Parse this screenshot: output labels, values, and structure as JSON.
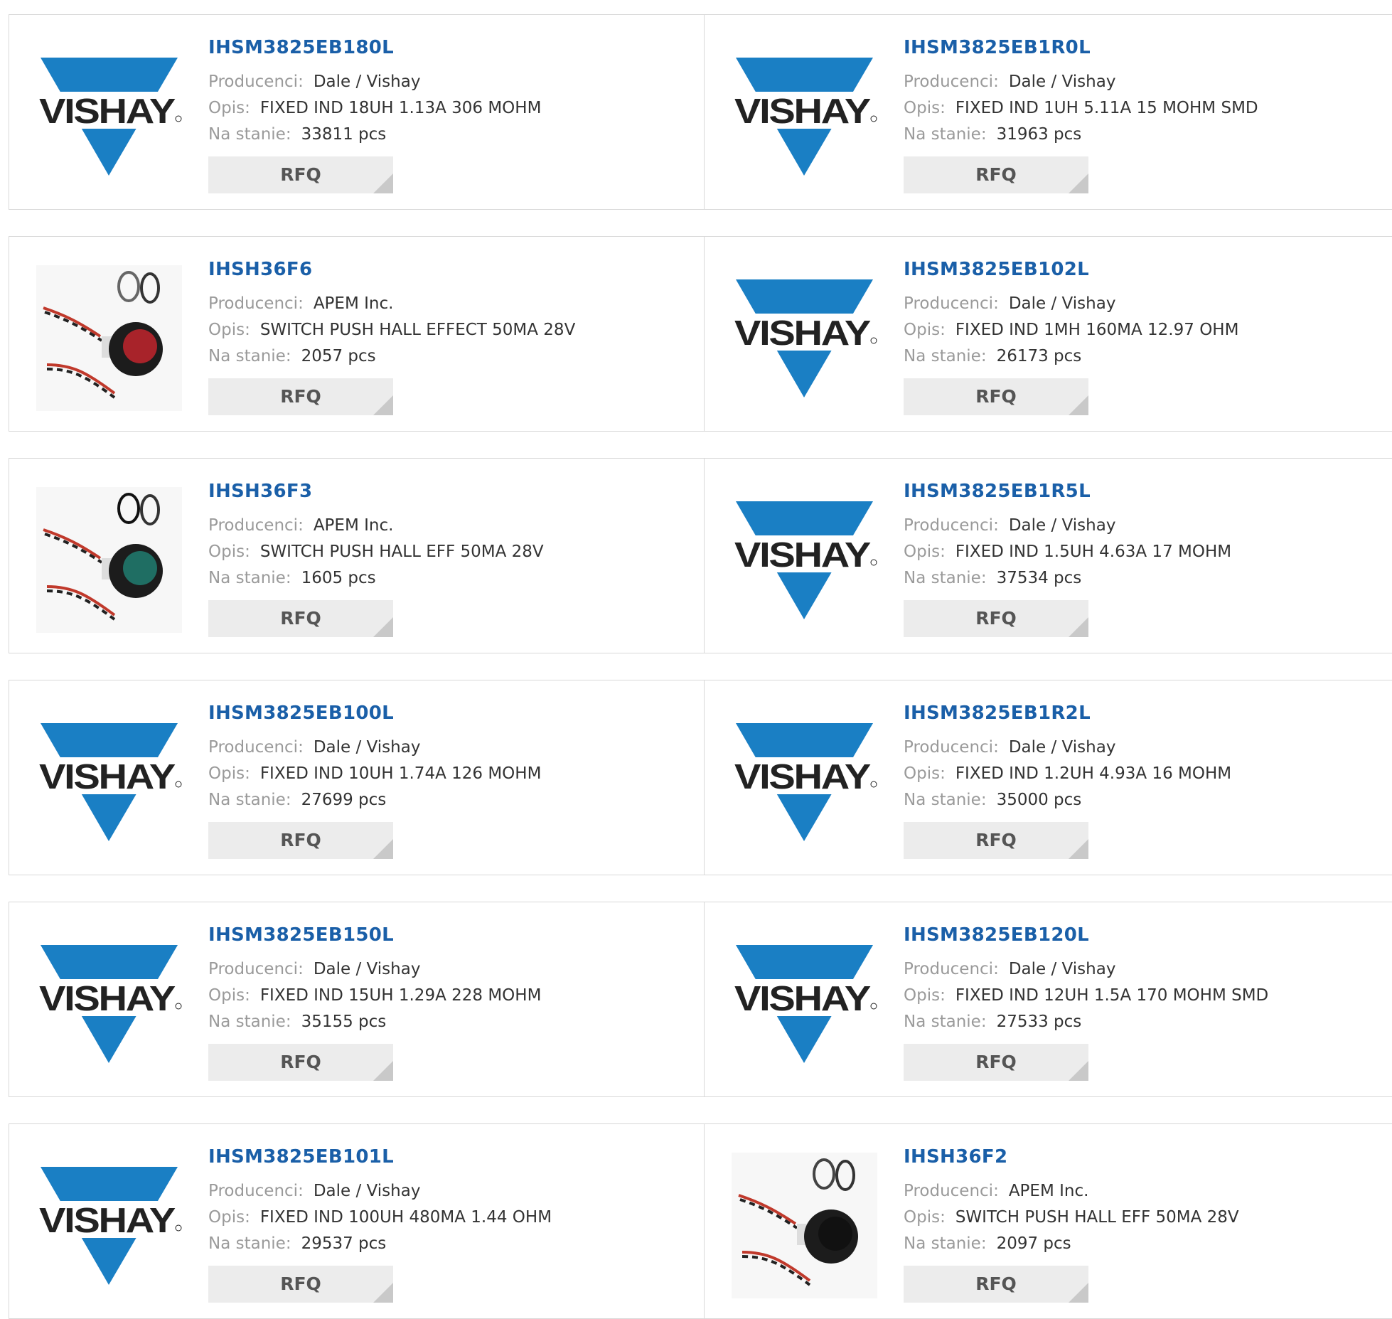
{
  "labels": {
    "manufacturer": "Producenci:",
    "description": "Opis:",
    "stock": "Na stanie:",
    "rfq": "RFQ"
  },
  "colors": {
    "link": "#1a5fa8",
    "vishay_blue": "#1a7fc4",
    "button_bg": "#ececec"
  },
  "products": [
    {
      "part": "IHSM3825EB180L",
      "manufacturer": "Dale / Vishay",
      "description": "FIXED IND 18UH 1.13A 306 MOHM",
      "stock": "33811 pcs",
      "image": "vishay-logo",
      "logo_text": "VISHAY"
    },
    {
      "part": "IHSM3825EB1R0L",
      "manufacturer": "Dale / Vishay",
      "description": "FIXED IND 1UH 5.11A 15 MOHM SMD",
      "stock": "31963 pcs",
      "image": "vishay-logo",
      "logo_text": "VISHAY"
    },
    {
      "part": "IHSH36F6",
      "manufacturer": "APEM Inc.",
      "description": "SWITCH PUSH HALL EFFECT 50MA 28V",
      "stock": "2057 pcs",
      "image": "red-switch-photo"
    },
    {
      "part": "IHSM3825EB102L",
      "manufacturer": "Dale / Vishay",
      "description": "FIXED IND 1MH 160MA 12.97 OHM",
      "stock": "26173 pcs",
      "image": "vishay-logo",
      "logo_text": "VISHAY"
    },
    {
      "part": "IHSH36F3",
      "manufacturer": "APEM Inc.",
      "description": "SWITCH PUSH HALL EFF 50MA 28V",
      "stock": "1605 pcs",
      "image": "green-switch-photo"
    },
    {
      "part": "IHSM3825EB1R5L",
      "manufacturer": "Dale / Vishay",
      "description": "FIXED IND 1.5UH 4.63A 17 MOHM",
      "stock": "37534 pcs",
      "image": "vishay-logo",
      "logo_text": "VISHAY"
    },
    {
      "part": "IHSM3825EB100L",
      "manufacturer": "Dale / Vishay",
      "description": "FIXED IND 10UH 1.74A 126 MOHM",
      "stock": "27699 pcs",
      "image": "vishay-logo",
      "logo_text": "VISHAY"
    },
    {
      "part": "IHSM3825EB1R2L",
      "manufacturer": "Dale / Vishay",
      "description": "FIXED IND 1.2UH 4.93A 16 MOHM",
      "stock": "35000 pcs",
      "image": "vishay-logo",
      "logo_text": "VISHAY"
    },
    {
      "part": "IHSM3825EB150L",
      "manufacturer": "Dale / Vishay",
      "description": "FIXED IND 15UH 1.29A 228 MOHM",
      "stock": "35155 pcs",
      "image": "vishay-logo",
      "logo_text": "VISHAY"
    },
    {
      "part": "IHSM3825EB120L",
      "manufacturer": "Dale / Vishay",
      "description": "FIXED IND 12UH 1.5A 170 MOHM SMD",
      "stock": "27533 pcs",
      "image": "vishay-logo",
      "logo_text": "VISHAY"
    },
    {
      "part": "IHSM3825EB101L",
      "manufacturer": "Dale / Vishay",
      "description": "FIXED IND 100UH 480MA 1.44 OHM",
      "stock": "29537 pcs",
      "image": "vishay-logo",
      "logo_text": "VISHAY"
    },
    {
      "part": "IHSH36F2",
      "manufacturer": "APEM Inc.",
      "description": "SWITCH PUSH HALL EFF 50MA 28V",
      "stock": "2097 pcs",
      "image": "black-switch-photo"
    }
  ]
}
